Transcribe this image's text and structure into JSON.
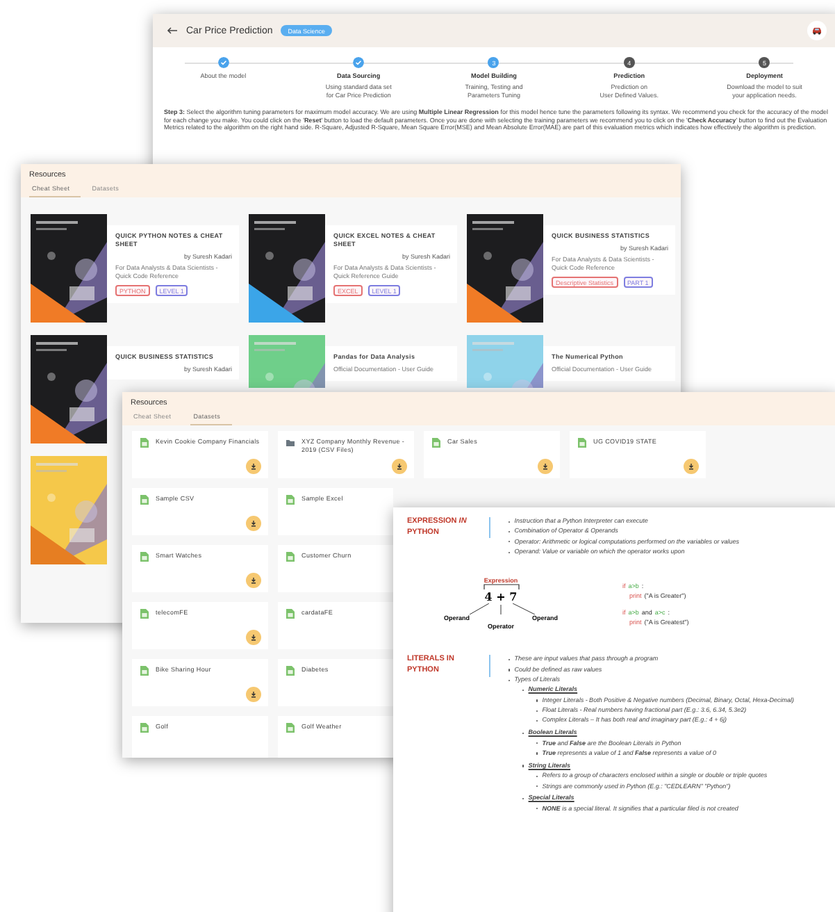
{
  "prediction_window": {
    "title": "Car Price Prediction",
    "badge": "Data Science",
    "steps": [
      {
        "done": true,
        "label": "About the model"
      },
      {
        "done": true,
        "title": "Data Sourcing",
        "lines": [
          "Using standard data set",
          "for Car Price Prediction"
        ]
      },
      {
        "done": false,
        "active": true,
        "number": "3",
        "title": "Model Building",
        "lines": [
          "Training, Testing and",
          "Parameters Tuning"
        ]
      },
      {
        "done": false,
        "active": false,
        "number": "4",
        "title": "Prediction",
        "lines": [
          "Prediction on",
          "User Defined Values."
        ]
      },
      {
        "done": false,
        "active": false,
        "number": "5",
        "title": "Deployment",
        "lines": [
          "Download the model to suit",
          "your application needs."
        ]
      }
    ],
    "instructions": "**Step 3:** Select the algorithm tuning parameters for maximum model accuracy. We are using **Multiple Linear Regression** for this model hence tune the parameters following its syntax. We recommend you check for the accuracy of the model for each change you make. You could click on the '**Reset**' button to load the default parameters. Once you are done with selecting the training parameters we recommend you to click on the '**Check Accuracy**' button to find out the Evaluation Metrics related to the algorithm on the right hand side. R-Square, Adjusted R-Square, Mean Square Error(MSE) and Mean Absolute Error(MAE) are part of this evaluation metrics which indicates how effectively the algorithm is prediction."
  },
  "cheat_sheet_window": {
    "title": "Resources",
    "tabs": [
      {
        "label": "Cheat Sheet",
        "selected": true
      },
      {
        "label": "Datasets",
        "selected": false
      }
    ],
    "cards": [
      {
        "title": "QUICK PYTHON NOTES & CHEAT SHEET",
        "author": "by Suresh Kadari",
        "description": "For Data Analysts & Data Scientists - Quick Code Reference",
        "tags": [
          {
            "label": "PYTHON",
            "color": "#e57373"
          },
          {
            "label": "LEVEL 1",
            "color": "#7e7ee0"
          }
        ]
      },
      {
        "title": "QUICK EXCEL NOTES & CHEAT SHEET",
        "author": "by Suresh Kadari",
        "description": "For Data Analysts & Data Scientists - Quick Reference Guide",
        "tags": [
          {
            "label": "EXCEL",
            "color": "#e57373"
          },
          {
            "label": "LEVEL 1",
            "color": "#7e7ee0"
          }
        ]
      },
      {
        "title": "QUICK BUSINESS STATISTICS",
        "author": "by Suresh Kadari",
        "description": "For Data Analysts & Data Scientists - Quick Code Reference",
        "tags": [
          {
            "label": "Descriptive Statistics",
            "color": "#e57373"
          },
          {
            "label": "PART 1",
            "color": "#7e7ee0"
          }
        ]
      },
      {
        "title": "QUICK BUSINESS STATISTICS",
        "author": "by Suresh Kadari"
      },
      {
        "title": "Pandas for Data Analysis",
        "description": "Official Documentation - User Guide"
      },
      {
        "title": "The Numerical Python",
        "description": "Official Documentation - User Guide"
      },
      {
        "kind": "picture"
      }
    ]
  },
  "datasets_window": {
    "title": "Resources",
    "tabs": [
      {
        "label": "Cheat Sheet",
        "selected": false
      },
      {
        "label": "Datasets",
        "selected": true
      }
    ],
    "datasets": [
      {
        "kind": "sheet",
        "name": "Kevin Cookie Company Financials",
        "download": true
      },
      {
        "kind": "folder",
        "name": "XYZ Company Monthly Revenue - 2019 (CSV Files)",
        "download": true
      },
      {
        "kind": "sheet",
        "name": "Car Sales",
        "download": true
      },
      {
        "kind": "sheet",
        "name": "UG COVID19 STATE",
        "download": true
      },
      {
        "kind": "sheet",
        "name": "Sample CSV",
        "download": true
      },
      {
        "kind": "sheet",
        "name": "Sample Excel",
        "download": false
      },
      {
        "kind": "sheet",
        "name": "Smart Watches",
        "download": true
      },
      {
        "kind": "sheet",
        "name": "Customer Churn",
        "download": false
      },
      {
        "kind": "sheet",
        "name": "telecomFE",
        "download": true
      },
      {
        "kind": "sheet",
        "name": "cardataFE",
        "download": false
      },
      {
        "kind": "sheet",
        "name": "Bike Sharing Hour",
        "download": true
      },
      {
        "kind": "sheet",
        "name": "Diabetes",
        "download": false
      },
      {
        "kind": "sheet",
        "name": "Golf",
        "download": false
      },
      {
        "kind": "sheet",
        "name": "Golf Weather",
        "download": false
      }
    ]
  },
  "notes_document": {
    "sections": [
      {
        "heading": "EXPRESSION *IN* PYTHON",
        "bullets": [
          {
            "text": "Instruction that a Python Interpreter can execute"
          },
          {
            "text": "Combination of Operator & Operands"
          },
          {
            "text": "Operator: Arithmetic or logical computations performed on the variables or values"
          },
          {
            "text": "Operand: Value or variable on which the operator works upon"
          }
        ],
        "diagram": {
          "caption": "Expression",
          "expression": "4 + 7",
          "left": "Operand",
          "middle": "Operator",
          "right": "Operand"
        },
        "code": [
          [
            {
              "kind": "keyword",
              "text": "if"
            },
            {
              "kind": "cond",
              "text": "a>b"
            },
            {
              "kind": "plain",
              "text": ":"
            }
          ],
          [
            {
              "kind": "fn",
              "text": "print"
            },
            {
              "kind": "plain",
              "text": "(\"A is Greater\")"
            }
          ],
          [
            {
              "kind": "keyword",
              "text": "if"
            },
            {
              "kind": "cond",
              "text": "a>b"
            },
            {
              "kind": "plain",
              "text": "and"
            },
            {
              "kind": "cond",
              "text": "a>c"
            },
            {
              "kind": "plain",
              "text": ":"
            }
          ],
          [
            {
              "kind": "fn",
              "text": "print"
            },
            {
              "kind": "plain",
              "text": "(\"A is Greatest\")"
            }
          ]
        ]
      },
      {
        "heading": "LITERALS IN PYTHON",
        "bullets": [
          {
            "text": "These are input values that pass through a program"
          },
          {
            "text": "Could be defined as raw values"
          },
          {
            "text": "Types of Literals",
            "children": [
              {
                "text": "Numeric Literals",
                "children": [
                  {
                    "text": "Integer Literals - Both Positive & Negative numbers (Decimal, Binary, Octal, Hexa-Decimal)"
                  },
                  {
                    "text": "Float Literals - Real numbers having fractional part (E.g.: 3.6, 6.34, 5.3e2)"
                  },
                  {
                    "text": "Complex Literals – It has both real and imaginary part (E.g.: 4 + 6j)"
                  }
                ]
              },
              {
                "text": "Boolean Literals",
                "children": [
                  {
                    "text": "**True** and **False** are the Boolean Literals in Python"
                  },
                  {
                    "text": "**True** represents a value of 1 and **False** represents a value of 0"
                  }
                ]
              },
              {
                "text": "String Literals",
                "children": [
                  {
                    "text": "Refers to a group of characters enclosed within a single or double or triple quotes"
                  },
                  {
                    "text": "Strings are commonly used in Python (E.g.: \"CEDLEARN\" \"Python\")"
                  }
                ]
              },
              {
                "text": "Special Literals",
                "children": [
                  {
                    "text": "**NONE** is a special literal. It signifies that a particular filed is not created"
                  }
                ]
              }
            ]
          }
        ]
      }
    ]
  }
}
